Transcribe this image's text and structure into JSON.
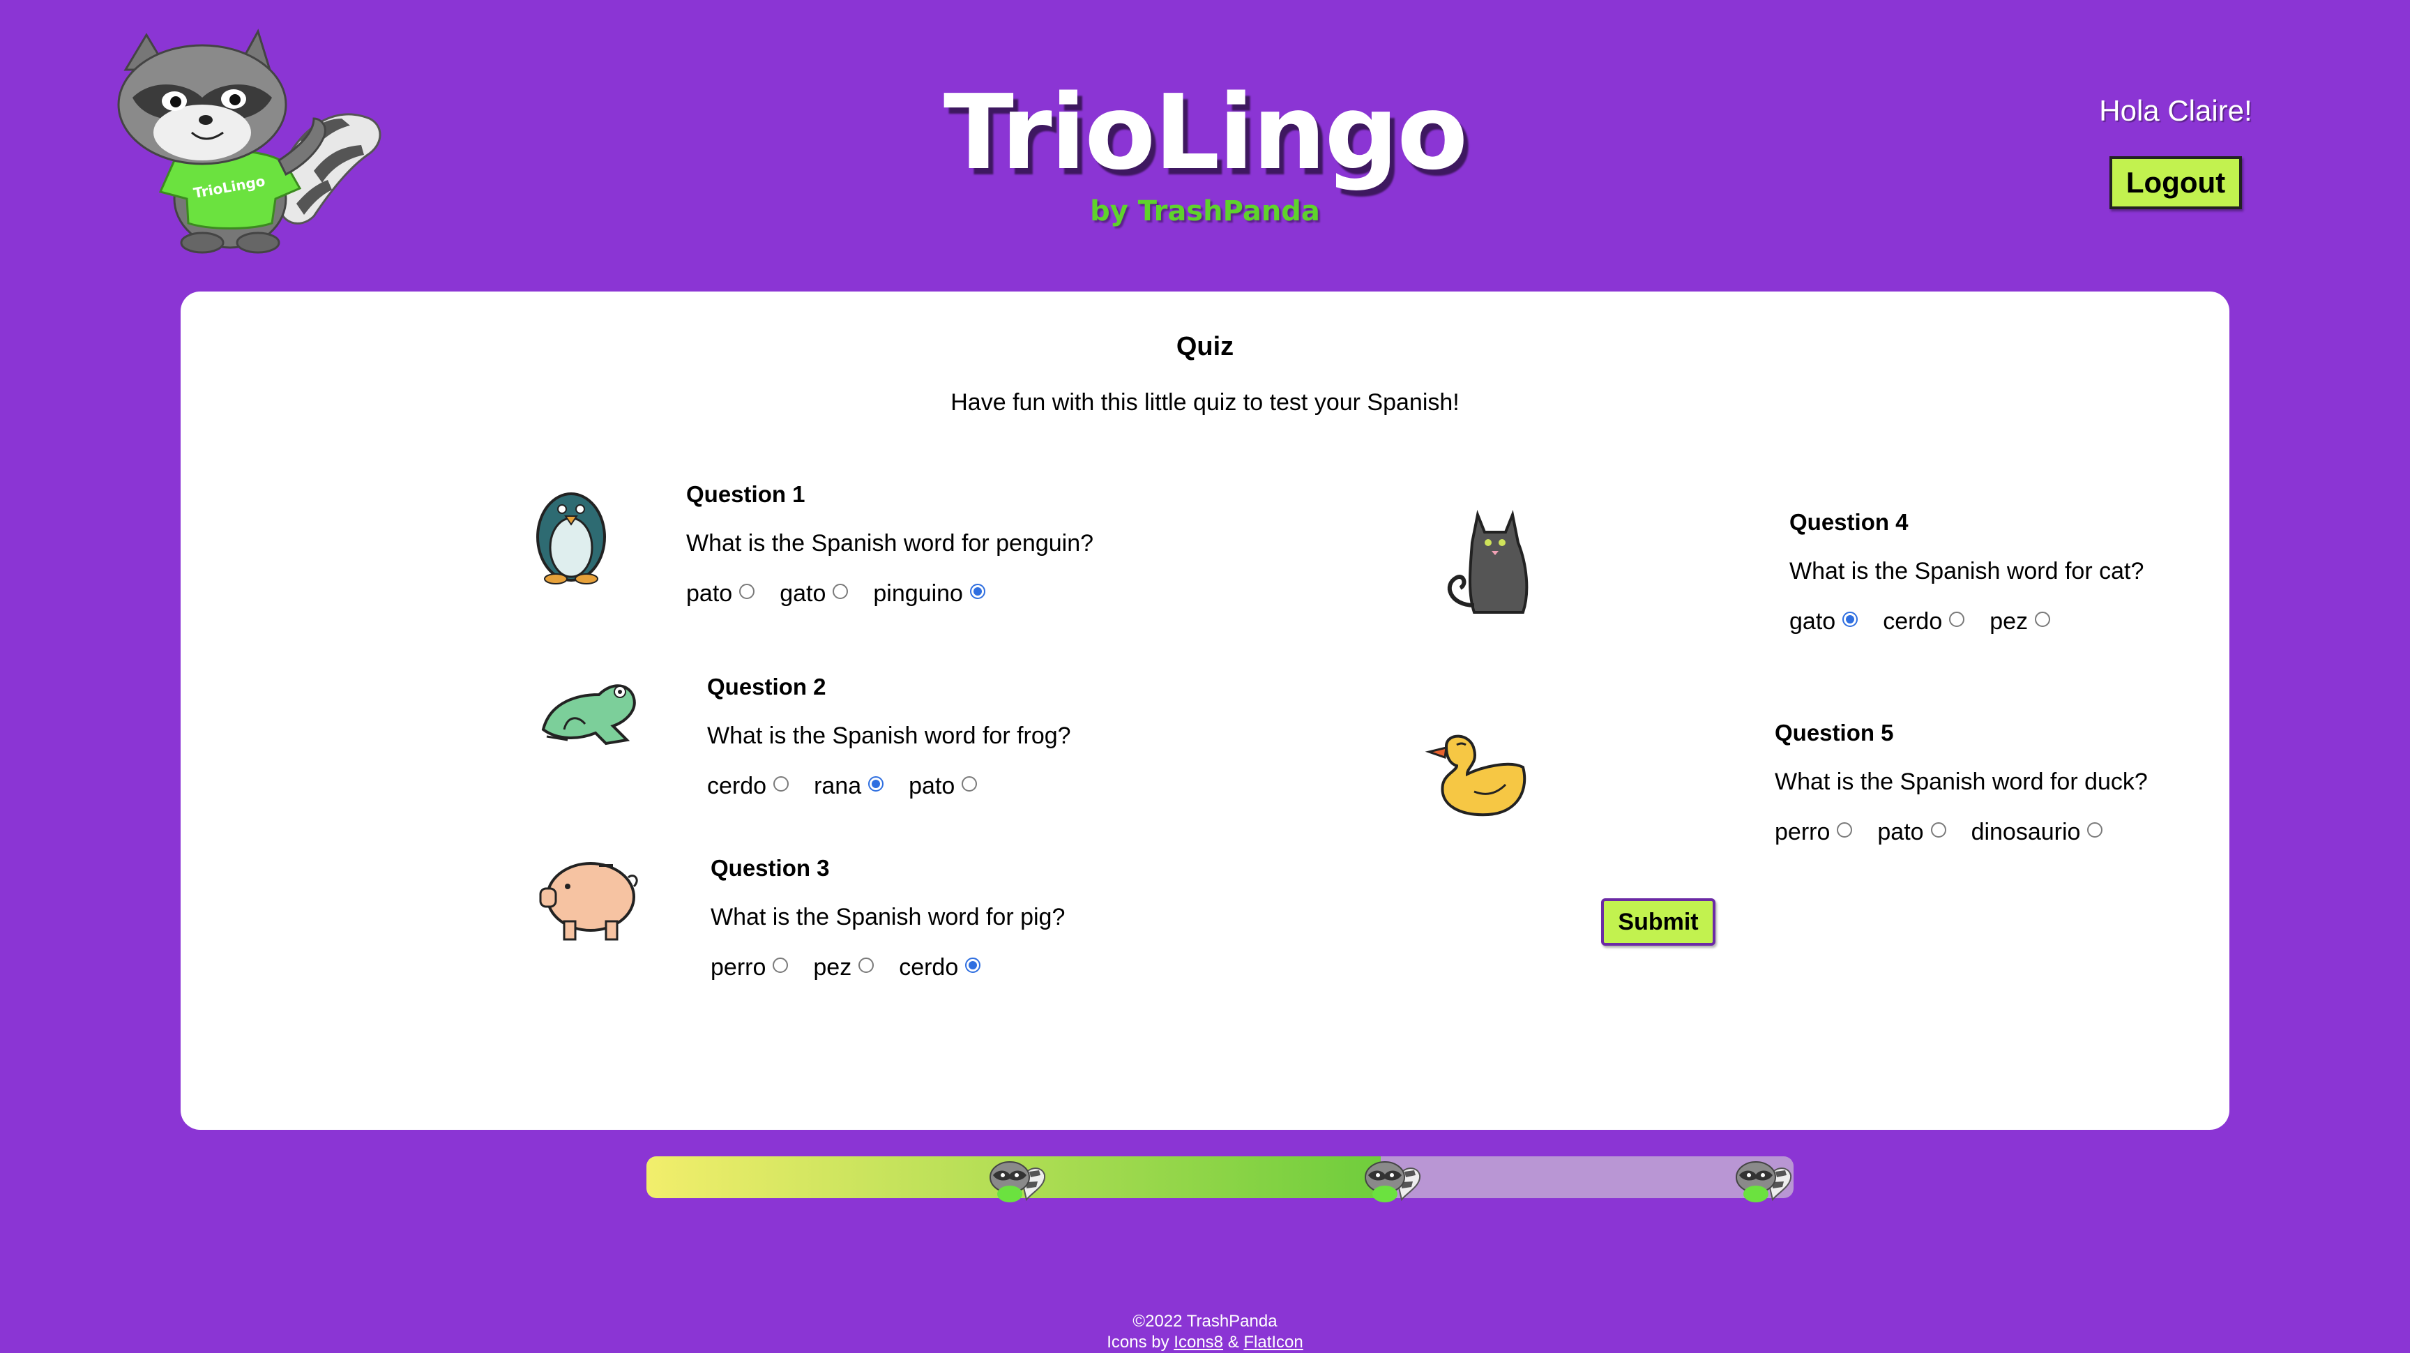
{
  "header": {
    "title": "TrioLingo",
    "subtitle": "by TrashPanda",
    "greeting": "Hola Claire!",
    "logout_label": "Logout",
    "mascot_shirt_text": "TrioLingo"
  },
  "quiz": {
    "title": "Quiz",
    "intro": "Have fun with this little quiz to test your Spanish!",
    "questions": [
      {
        "title": "Question 1",
        "text": "What is the Spanish word for penguin?",
        "icon": "penguin-icon",
        "options": [
          "pato",
          "gato",
          "pinguino"
        ],
        "selected": "pinguino"
      },
      {
        "title": "Question 2",
        "text": "What is the Spanish word for frog?",
        "icon": "frog-icon",
        "options": [
          "cerdo",
          "rana",
          "pato"
        ],
        "selected": "rana"
      },
      {
        "title": "Question 3",
        "text": "What is the Spanish word for pig?",
        "icon": "pig-icon",
        "options": [
          "perro",
          "pez",
          "cerdo"
        ],
        "selected": "cerdo"
      },
      {
        "title": "Question 4",
        "text": "What is the Spanish word for cat?",
        "icon": "cat-icon",
        "options": [
          "gato",
          "cerdo",
          "pez"
        ],
        "selected": "gato"
      },
      {
        "title": "Question 5",
        "text": "What is the Spanish word for duck?",
        "icon": "duck-icon",
        "options": [
          "perro",
          "pato",
          "dinosaurio"
        ],
        "selected": null
      }
    ],
    "submit_label": "Submit"
  },
  "progress": {
    "value_percent": 64,
    "milestone_icon": "raccoon-icon"
  },
  "footer": {
    "copyright": "©2022 TrashPanda",
    "credits_prefix": "Icons by",
    "link1": "Icons8",
    "separator": "&",
    "link2": "FlatIcon"
  },
  "colors": {
    "background": "#8b35d4",
    "accent_button": "#c2f24f",
    "subtitle_green": "#5fd32c",
    "progress_track": "#b996d4",
    "radio_selected": "#2f6fe0"
  }
}
